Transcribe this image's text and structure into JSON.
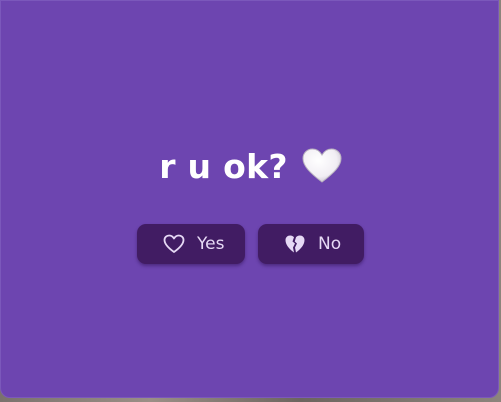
{
  "dialog": {
    "question": "r u ok?",
    "question_icon": "white-heart-icon",
    "buttons": [
      {
        "label": "Yes",
        "icon": "heart-outline-icon"
      },
      {
        "label": "No",
        "icon": "broken-heart-icon"
      }
    ]
  },
  "colors": {
    "window_background": "#6d45b0",
    "button_background": "#411c63",
    "button_text": "#e6d9f5",
    "title_text": "#ffffff"
  }
}
